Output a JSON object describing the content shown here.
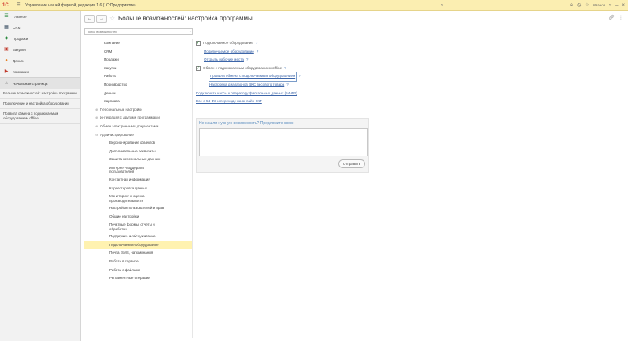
{
  "titlebar": {
    "logo": "1С",
    "title": "Управление нашей фирмой, редакция 1.6  (1С:Предприятие)",
    "search_icon": "search-icon",
    "user": "Иванов",
    "icons": [
      "bell-icon",
      "history-icon",
      "star-icon",
      "user-icon",
      "minimize-icon",
      "close-icon"
    ]
  },
  "left_panel": {
    "sections": [
      {
        "label": "Главное",
        "icon": "main-icon"
      },
      {
        "label": "CRM",
        "icon": "crm-icon"
      },
      {
        "label": "Продажи",
        "icon": "sales-icon"
      },
      {
        "label": "Закупки",
        "icon": "purchase-icon"
      },
      {
        "label": "Деньги",
        "icon": "money-icon"
      },
      {
        "label": "Компания",
        "icon": "company-icon"
      }
    ],
    "home": "Начальная страница",
    "open_windows": [
      "Больше возможностей: настройка программы",
      "Подключение и настройка оборудования",
      "Правила обмена с подключаемым оборудованием offline"
    ]
  },
  "form": {
    "back": "←",
    "forward": "→",
    "title": "Больше возможностей: настройка программы",
    "tools": [
      "link-icon",
      "more-icon"
    ],
    "search_placeholder": "Поиск возможностей",
    "search_clear": "×"
  },
  "sections_list": [
    {
      "label": "Компания",
      "kind": "item"
    },
    {
      "label": "CRM",
      "kind": "item"
    },
    {
      "label": "Продажи",
      "kind": "item"
    },
    {
      "label": "Закупки",
      "kind": "item"
    },
    {
      "label": "Работы",
      "kind": "item"
    },
    {
      "label": "Производство",
      "kind": "item"
    },
    {
      "label": "Деньги",
      "kind": "item"
    },
    {
      "label": "Зарплата",
      "kind": "item"
    },
    {
      "label": "Персональные настройки",
      "kind": "group"
    },
    {
      "label": "Интеграция с другими программами",
      "kind": "group"
    },
    {
      "label": "Обмен электронными документами",
      "kind": "group"
    },
    {
      "label": "Администрирование",
      "kind": "group"
    },
    {
      "label": "Версионирование объектов",
      "kind": "sub"
    },
    {
      "label": "Дополнительные реквизиты",
      "kind": "sub"
    },
    {
      "label": "Защита персональных данных",
      "kind": "sub"
    },
    {
      "label": "Интернет-поддержка пользователей",
      "kind": "sub2"
    },
    {
      "label": "Контактная информация",
      "kind": "sub"
    },
    {
      "label": "Корректировка данных",
      "kind": "sub"
    },
    {
      "label": "Мониторинг и оценка производительности",
      "kind": "sub2"
    },
    {
      "label": "Настройки пользователей и прав",
      "kind": "sub"
    },
    {
      "label": "Общие настройки",
      "kind": "sub"
    },
    {
      "label": "Печатные формы, отчеты и обработки",
      "kind": "sub2"
    },
    {
      "label": "Поддержка и обслуживание",
      "kind": "sub"
    },
    {
      "label": "Подключаемое оборудование",
      "kind": "selected"
    },
    {
      "label": "Почта, SMS, напоминания",
      "kind": "sub"
    },
    {
      "label": "Работа в сервисе",
      "kind": "sub"
    },
    {
      "label": "Работа с файлами",
      "kind": "sub"
    },
    {
      "label": "Регламентные операции",
      "kind": "sub"
    }
  ],
  "content": {
    "use_equipment": "Подключаемое оборудование",
    "equipment_link": "Подключаемое оборудование",
    "workplaces_link": "Открыть рабочие места",
    "offline_exchange": "Обмен с подключаемым оборудованием offline",
    "exchange_rules_link": "Правила обмена с подключаемым оборудованием",
    "scales_link": "Настройка диапазонов ВКС весового товара",
    "ofd_link": "Подключить кассы к оператору фискальных данных (54-ФЗ)",
    "law_link": "Все о 54-ФЗ и переходе на онлайн-ККТ",
    "help": "?"
  },
  "suggest": {
    "title": "Не нашли нужную возможность? Предложите свою",
    "send": "Отправить"
  }
}
